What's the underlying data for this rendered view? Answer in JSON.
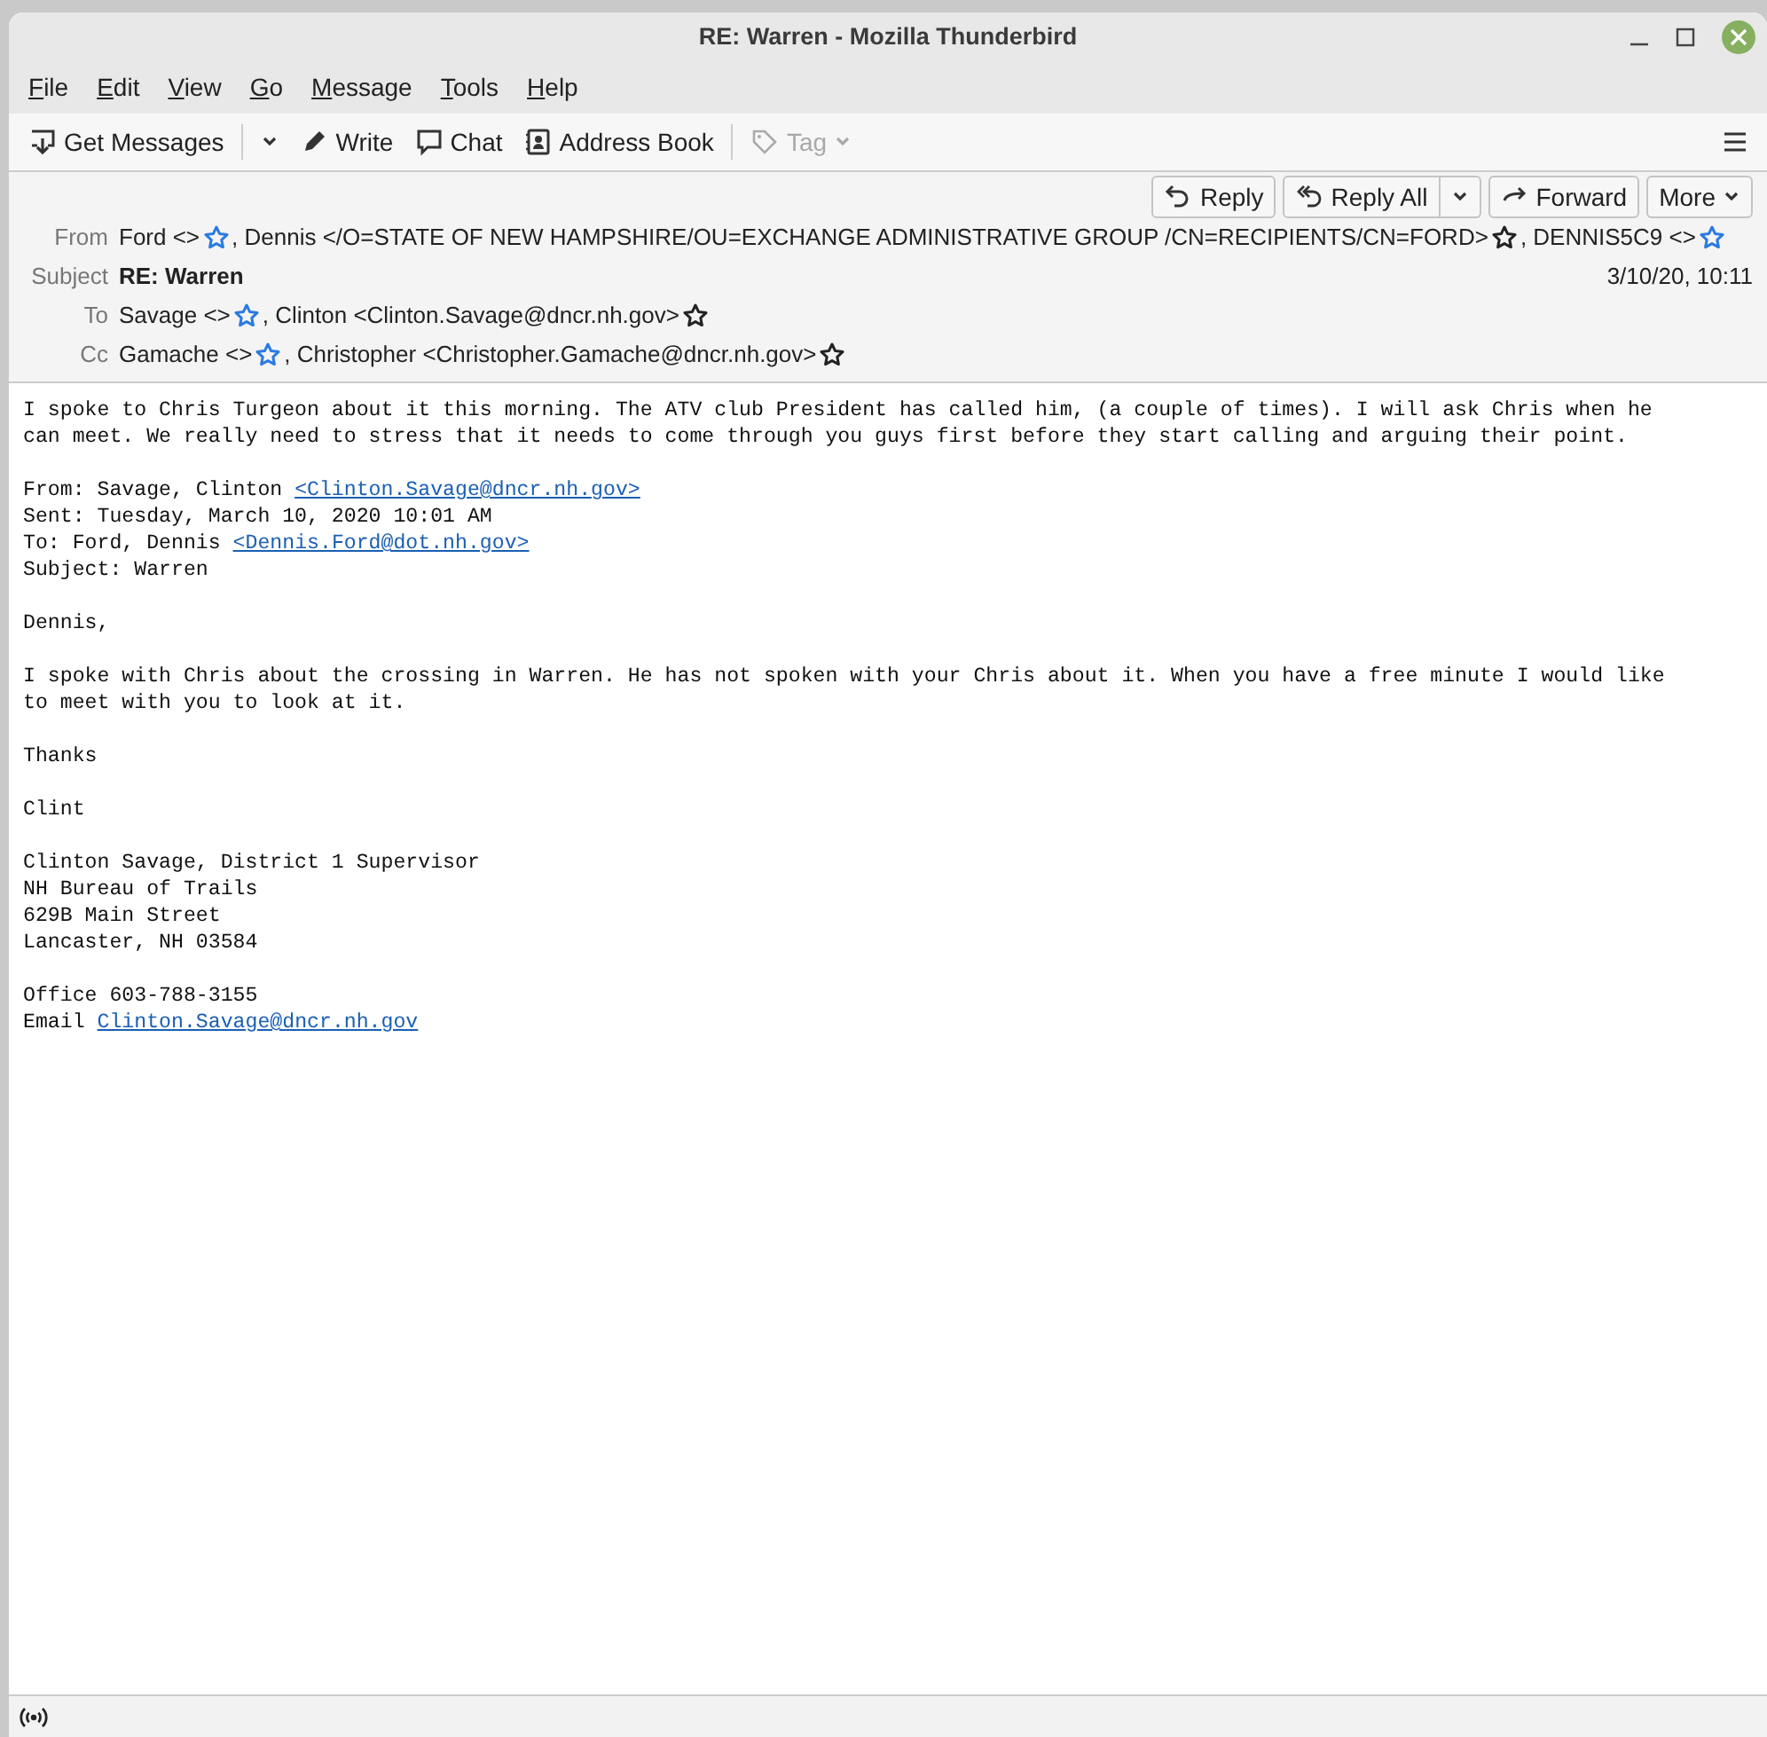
{
  "window": {
    "title": "RE: Warren - Mozilla Thunderbird"
  },
  "menu": [
    "File",
    "Edit",
    "View",
    "Go",
    "Message",
    "Tools",
    "Help"
  ],
  "toolbar": [
    {
      "kind": "get",
      "label": "Get Messages",
      "dropdown": true,
      "disabled": false
    },
    {
      "kind": "write",
      "label": "Write",
      "dropdown": false,
      "disabled": false
    },
    {
      "kind": "chat",
      "label": "Chat",
      "dropdown": false,
      "disabled": false
    },
    {
      "kind": "addressbook",
      "label": "Address Book",
      "dropdown": false,
      "disabled": false
    },
    {
      "kind": "tag",
      "label": "Tag",
      "dropdown": true,
      "disabled": true
    }
  ],
  "actions": [
    {
      "kind": "reply",
      "label": "Reply",
      "dropdown": false
    },
    {
      "kind": "replyall",
      "label": "Reply All",
      "dropdown": true
    },
    {
      "kind": "forward",
      "label": "Forward",
      "dropdown": false
    },
    {
      "kind": "more",
      "label": "More",
      "dropdown": true
    }
  ],
  "header": {
    "from": {
      "label": "From",
      "people": [
        {
          "text": "Ford <>",
          "known": false
        },
        {
          "text": ", Dennis </O=STATE OF NEW HAMPSHIRE/OU=EXCHANGE ADMINISTRATIVE GROUP /CN=RECIPIENTS/CN=FORD>",
          "known": true
        },
        {
          "text": ", DENNIS5C9 <>",
          "known": false
        }
      ]
    },
    "subject": {
      "label": "Subject",
      "value": "RE: Warren"
    },
    "date": "3/10/20, 10:11",
    "to": {
      "label": "To",
      "people": [
        {
          "text": "Savage <>",
          "known": false
        },
        {
          "text": ", Clinton <Clinton.Savage@dncr.nh.gov>",
          "known": true
        }
      ]
    },
    "cc": {
      "label": "Cc",
      "people": [
        {
          "text": "Gamache <>",
          "known": false
        },
        {
          "text": ", Christopher <Christopher.Gamache@dncr.nh.gov>",
          "known": true
        }
      ]
    }
  },
  "body": [
    {
      "lines": [
        [
          {
            "text": "I spoke to Chris Turgeon about it this morning. The ATV club President has called him, (a couple of times). I will ask Chris when he"
          }
        ],
        [
          {
            "text": "can meet. We really need to stress that it needs to come through you guys first before they start calling and arguing their point."
          }
        ]
      ]
    },
    {
      "lines": [
        [
          {
            "text": "From: Savage, Clinton "
          },
          {
            "text": "<Clinton.Savage@dncr.nh.gov>",
            "link": true
          }
        ],
        [
          {
            "text": "Sent: Tuesday, March 10, 2020 10:01 AM"
          }
        ],
        [
          {
            "text": "To: Ford, Dennis "
          },
          {
            "text": "<Dennis.Ford@dot.nh.gov>",
            "link": true
          }
        ],
        [
          {
            "text": "Subject: Warren"
          }
        ]
      ]
    },
    {
      "lines": [
        [
          {
            "text": "Dennis,"
          }
        ]
      ]
    },
    {
      "lines": [
        [
          {
            "text": "I spoke with Chris about the crossing in Warren. He has not spoken with your Chris about it. When you have a free minute I would like"
          }
        ],
        [
          {
            "text": "to meet with you to look at it."
          }
        ]
      ]
    },
    {
      "lines": [
        [
          {
            "text": "Thanks"
          }
        ]
      ]
    },
    {
      "lines": [
        [
          {
            "text": "Clint"
          }
        ]
      ]
    },
    {
      "lines": [
        [
          {
            "text": "Clinton Savage, District 1 Supervisor"
          }
        ],
        [
          {
            "text": "NH Bureau of Trails"
          }
        ],
        [
          {
            "text": "629B Main Street"
          }
        ],
        [
          {
            "text": "Lancaster, NH 03584"
          }
        ]
      ]
    },
    {
      "lines": [
        [
          {
            "text": "Office 603-788-3155"
          }
        ],
        [
          {
            "text": "Email "
          },
          {
            "text": "Clinton.Savage@dncr.nh.gov",
            "link": true
          }
        ]
      ]
    }
  ]
}
